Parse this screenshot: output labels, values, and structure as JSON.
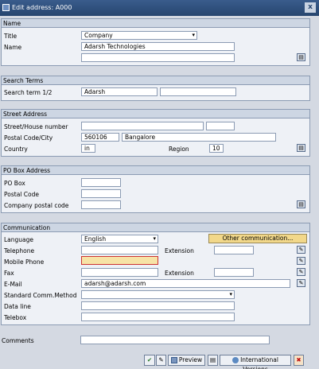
{
  "window": {
    "title": "Edit address: A000",
    "close": "x"
  },
  "name_group": {
    "heading": "Name",
    "title_label": "Title",
    "title_value": "Company",
    "name_label": "Name",
    "name_value": "Adarsh Technologies"
  },
  "search_group": {
    "heading": "Search Terms",
    "label": "Search term 1/2",
    "term1": "Adarsh",
    "term2": ""
  },
  "street_group": {
    "heading": "Street Address",
    "street_label": "Street/House number",
    "postal_label": "Postal Code/City",
    "postal_code": "560106",
    "city": "Bangalore",
    "country_label": "Country",
    "country": "in",
    "region_label": "Region",
    "region": "10"
  },
  "pobox_group": {
    "heading": "PO Box Address",
    "pobox_label": "PO Box",
    "postal_code_label": "Postal Code",
    "company_postal_label": "Company postal code"
  },
  "comm_group": {
    "heading": "Communication",
    "language_label": "Language",
    "language": "English",
    "other_comm_button": "Other communication...",
    "telephone_label": "Telephone",
    "extension_label": "Extension",
    "mobile_label": "Mobile Phone",
    "fax_label": "Fax",
    "fax_ext_label": "Extension",
    "email_label": "E-Mail",
    "email": "adarsh@adarsh.com",
    "std_comm_label": "Standard Comm.Method",
    "dataline_label": "Data line",
    "telebox_label": "Telebox"
  },
  "comments": {
    "label": "Comments",
    "value": ""
  },
  "toolbar": {
    "preview": "Preview",
    "intl_versions": "International Versions"
  }
}
